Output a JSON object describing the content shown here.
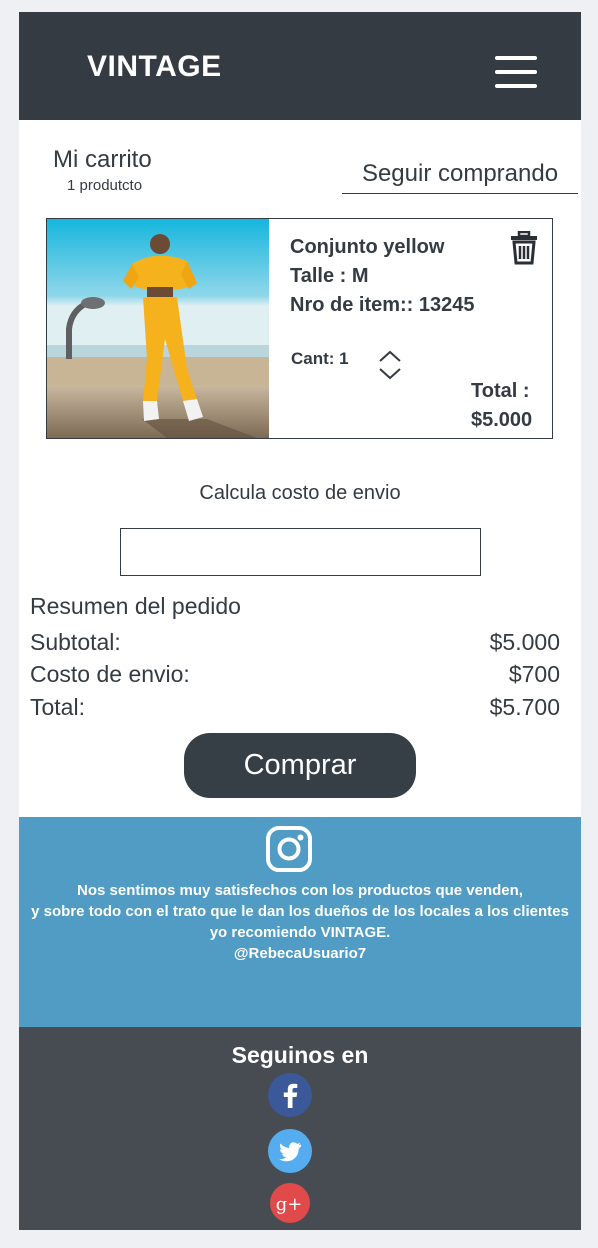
{
  "header": {
    "brand": "VINTAGE",
    "menu_icon": "hamburger-menu-icon"
  },
  "cart": {
    "title": "Mi carrito",
    "count": "1 produtcto",
    "continue_label": "Seguir comprando"
  },
  "product": {
    "name": "Conjunto yellow",
    "size": "Talle : M",
    "item_number": "Nro de item:: 13245",
    "quantity": "Cant: 1",
    "total_label": "Total :",
    "total_value": "$5.000",
    "delete_icon": "trash-icon",
    "stepper_icon": "chevron-up-down-icon"
  },
  "shipping": {
    "label": "Calcula costo de envio",
    "value": "",
    "placeholder": ""
  },
  "summary": {
    "title": "Resumen del pedido",
    "rows": [
      {
        "label": "Subtotal:",
        "value": "$5.000"
      },
      {
        "label": "Costo de envio:",
        "value": "$700"
      },
      {
        "label": "Total:",
        "value": "$5.700"
      }
    ],
    "buy_label": "Comprar"
  },
  "testimonial": {
    "icon": "instagram-icon",
    "lines": [
      "Nos sentimos  muy satisfechos con los productos que venden,",
      "y sobre todo con el trato que le dan los dueños de los locales a los clientes",
      "yo recomiendo VINTAGE.",
      "@RebecaUsuario7"
    ]
  },
  "social": {
    "title": "Seguinos en",
    "icons": [
      "facebook-icon",
      "twitter-icon",
      "google-plus-icon"
    ]
  },
  "colors": {
    "header_bg": "#353b42",
    "button_bg": "#353f45",
    "testimonial_bg": "#519cc4",
    "footer_bg": "#474b52",
    "facebook": "#3b5998",
    "twitter": "#55acee",
    "google_plus": "#dd4b39"
  }
}
